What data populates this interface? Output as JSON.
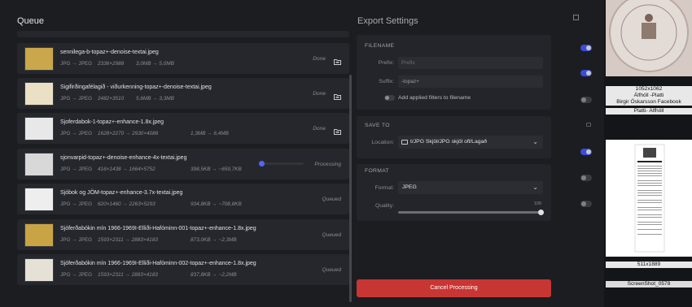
{
  "queue": {
    "title": "Queue",
    "items": [
      {
        "name": "sennilega-b-topaz+-denoise-textai.jpeg",
        "formats": "JPG → JPEG",
        "dims": "2336×2988",
        "sizes": "3,0MB → 5,0MB",
        "status": "Done",
        "thumb_color": "#c9a74a"
      },
      {
        "name": "Sigifirðingafélagið - viðurkenning-topaz+-denoise-textai.jpeg",
        "formats": "JPG → JPEG",
        "dims": "2482×3510",
        "sizes": "5,6MB → 3,3MB",
        "status": "Done",
        "thumb_color": "#e9e0c6"
      },
      {
        "name": "Sjoferdabok-1-topaz+-enhance-1.8x.jpeg",
        "formats": "JPG → JPEG",
        "dims": "1628×2270 → 2930×4086",
        "sizes": "1,3MB → 6,4MB",
        "status": "Done",
        "thumb_color": "#e8e8e8"
      },
      {
        "name": "sjonvarpid-topaz+-denoise-enhance-4x-textai.jpeg",
        "formats": "JPG → JPEG",
        "dims": "416×1438 → 1664×5752",
        "sizes": "398,5KB → ~659,7KB",
        "status": "Processing",
        "progress": 0.04,
        "thumb_color": "#d8d8d8"
      },
      {
        "name": "Sjóbok og JÖM-topaz+-enhance-3.7x-textai.jpeg",
        "formats": "JPG → JPEG",
        "dims": "620×1460 → 2263×5293",
        "sizes": "934,8KB → ~708,8KB",
        "status": "Queued",
        "thumb_color": "#eeeeee"
      },
      {
        "name": "Sjóferðabókin mín 1966-1969I-Elliði-Hafóminn-001-topaz+-enhance-1.8x.jpeg",
        "formats": "JPG → JPEG",
        "dims": "1593×2311 → 2883×4183",
        "sizes": "873,0KB → ~2,3MB",
        "status": "Queued",
        "thumb_color": "#c8a444"
      },
      {
        "name": "Sjóferðabókin mín 1966-1969I-Elliði-Hafóminn-002-topaz+-enhance-1.8x.jpeg",
        "formats": "JPG → JPEG",
        "dims": "1593×2311 → 2883×4183",
        "sizes": "837,8KB → ~2,2MB",
        "status": "Queued",
        "thumb_color": "#e6e1d6"
      }
    ]
  },
  "export": {
    "title": "Export Settings",
    "filename": {
      "header": "FILENAME",
      "prefix_label": "Prefix:",
      "prefix_placeholder": "Prefix",
      "suffix_label": "Suffix:",
      "suffix_value": "-topaz+",
      "add_filters_label": "Add applied filters to filename",
      "add_filters_on": false
    },
    "save_to": {
      "header": "SAVE TO",
      "location_label": "Location:",
      "location_value": "t/JPG Skjöl/JPG skjöl ofl/Lagað"
    },
    "format": {
      "header": "FORMAT",
      "format_label": "Format:",
      "format_value": "JPEG",
      "quality_label": "Quality:",
      "quality_value": "100"
    },
    "cancel_label": "Cancel Processing"
  },
  "right_panel": {
    "card1_caption": [
      "1052x1062",
      "Álfhóll -Platti",
      "Birgir Óskarsson Facebook",
      "Platti- Álfhóll"
    ],
    "card2_caption": [
      "511x1889"
    ],
    "card2_name": "ScreenShot_0578",
    "toggles": [
      true,
      true,
      false,
      true,
      false,
      false
    ]
  },
  "colors": {
    "accent": "#4a5aef",
    "cancel": "#c83634",
    "background": "#1c1d21"
  }
}
